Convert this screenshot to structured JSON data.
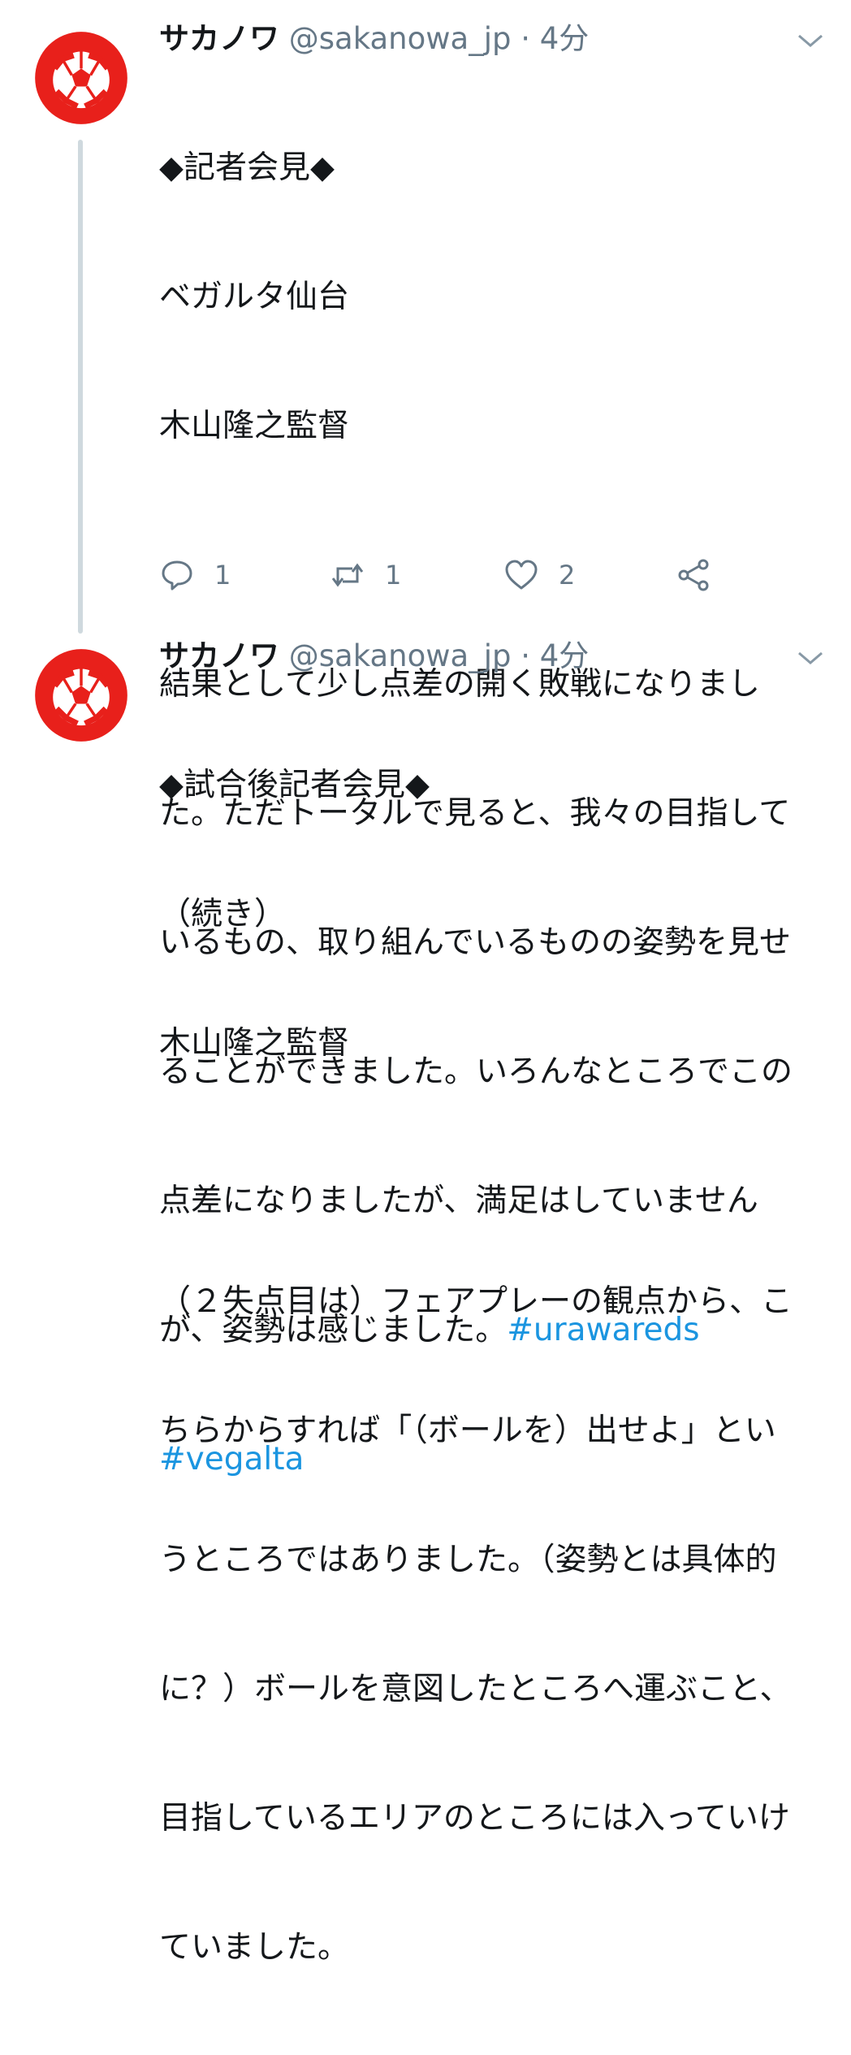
{
  "tweets": [
    {
      "author": "サカノワ",
      "handle": "@sakanowa_jp",
      "separator": "·",
      "time": "4分",
      "lines": [
        "◆記者会見◆",
        "ベガルタ仙台",
        "木山隆之監督",
        "",
        "結果として少し点差の開く敗戦になりまし",
        "た。ただトータルで見ると、我々の目指して",
        "いるもの、取り組んでいるものの姿勢を見せ",
        "ることができました。いろんなところでこの",
        "点差になりましたが、満足はしていません"
      ],
      "last_line_text": "が、姿勢は感じました。",
      "hashtag_1": "#urawareds",
      "hashtag_2": "#vegalta",
      "replies": "1",
      "retweets": "1",
      "likes": "2"
    },
    {
      "author": "サカノワ",
      "handle": "@sakanowa_jp",
      "separator": "·",
      "time": "4分",
      "lines": [
        "◆試合後記者会見◆",
        "（続き）",
        "木山隆之監督",
        "",
        "（２失点目は）フェアプレーの観点から、こ",
        "ちらからすれば「（ボールを）出せよ」とい",
        "うところではありました。（姿勢とは具体的",
        "に？）ボールを意図したところへ運ぶこと、",
        "目指しているエリアのところには入っていけ",
        "ていました。"
      ]
    }
  ],
  "icons": {
    "avatar": "soccer-ball-avatar",
    "menu": "chevron-down-icon",
    "reply": "reply-icon",
    "retweet": "retweet-icon",
    "like": "heart-icon",
    "share": "share-icon"
  },
  "colors": {
    "avatar_red": "#e8201b",
    "hashtag": "#1b95e0",
    "muted": "#657786",
    "thread_line": "#cfd9de"
  }
}
